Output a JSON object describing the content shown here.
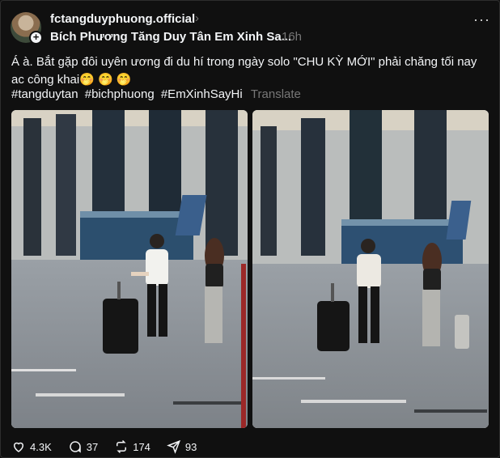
{
  "post": {
    "username": "fctangduyphuong.official",
    "subtitle": "Bích Phương Tăng Duy Tân Em Xinh Sa...",
    "time": "16h",
    "caption": "Á à. Bắt gặp đôi uyên ương đi du hí trong ngày solo \"CHU KỲ MỚI\" phải chăng tối nay ac công khai🤭 🤭 🤭",
    "hashtags": [
      "#tangduytan",
      "#bichphuong",
      "#EmXinhSayHi"
    ],
    "translate_label": "Translate"
  },
  "actions": {
    "likes": "4.3K",
    "comments": "37",
    "reposts": "174",
    "shares": "93"
  },
  "icons": {
    "more": "more-icon",
    "like": "heart-icon",
    "comment": "comment-icon",
    "repost": "repost-icon",
    "share": "send-icon",
    "follow": "plus-icon"
  }
}
